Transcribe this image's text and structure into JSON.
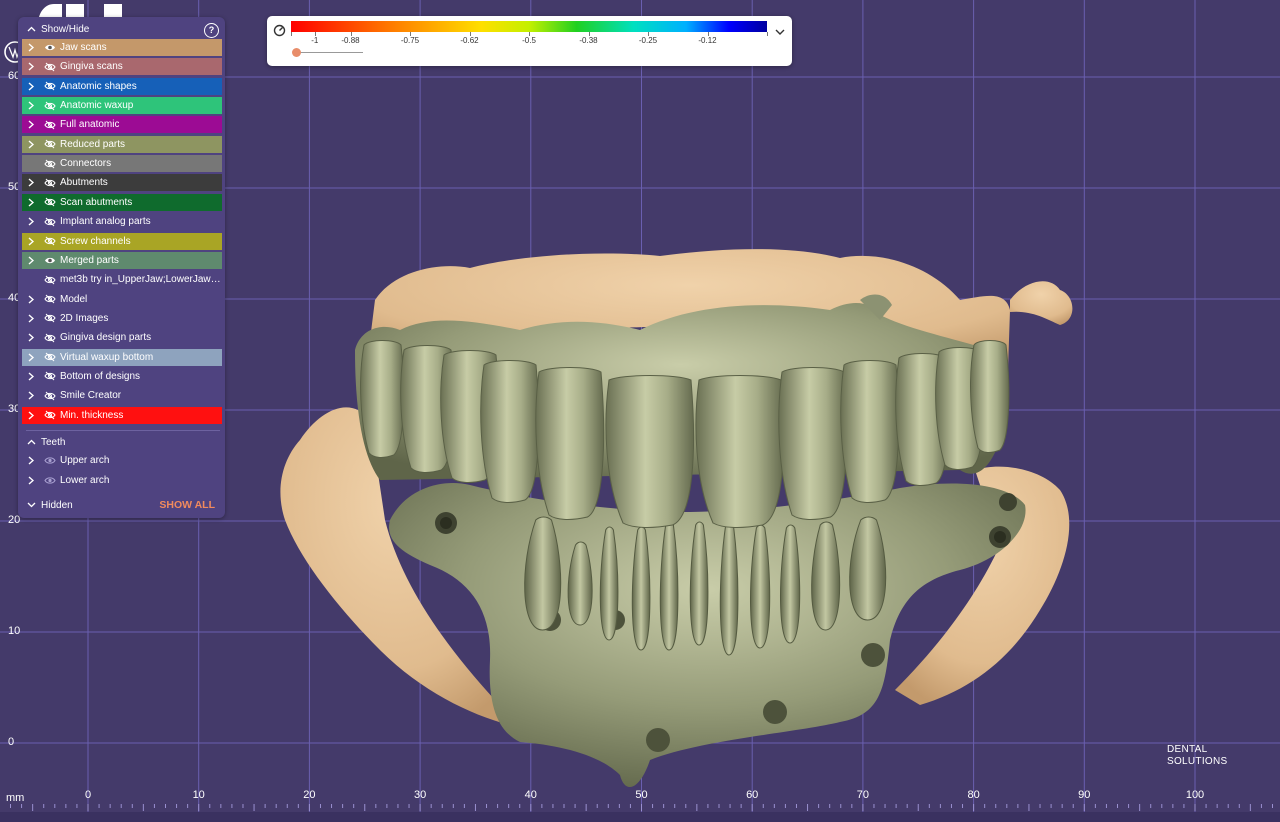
{
  "panel": {
    "show_hide_title": "Show/Hide",
    "help_label": "?",
    "items": [
      {
        "label": "Jaw scans",
        "color": "#c4986a",
        "visible": true,
        "expandable": true
      },
      {
        "label": "Gingiva scans",
        "color": "#a9686e",
        "visible": false,
        "expandable": true
      },
      {
        "label": "Anatomic shapes",
        "color": "#1660b8",
        "visible": false,
        "expandable": true
      },
      {
        "label": "Anatomic waxup",
        "color": "#2ec47a",
        "visible": false,
        "expandable": true
      },
      {
        "label": "Full anatomic",
        "color": "#9c0b94",
        "visible": false,
        "expandable": true
      },
      {
        "label": "Reduced parts",
        "color": "#8e9561",
        "visible": false,
        "expandable": true
      },
      {
        "label": "Connectors",
        "color": "#777777",
        "visible": false,
        "expandable": false
      },
      {
        "label": "Abutments",
        "color": "#3c3c3c",
        "visible": false,
        "expandable": true
      },
      {
        "label": "Scan abutments",
        "color": "#0f6b2d",
        "visible": false,
        "expandable": true
      },
      {
        "label": "Implant analog parts",
        "color": "",
        "visible": false,
        "expandable": true
      },
      {
        "label": "Screw channels",
        "color": "#a9a525",
        "visible": false,
        "expandable": true
      },
      {
        "label": "Merged parts",
        "color": "#5f8a6e",
        "visible": true,
        "expandable": true
      },
      {
        "label": "met3b try in_UpperJaw;LowerJaw (1...",
        "color": "",
        "visible": false,
        "expandable": false
      },
      {
        "label": "Model",
        "color": "",
        "visible": false,
        "expandable": true
      },
      {
        "label": "2D Images",
        "color": "",
        "visible": false,
        "expandable": true
      },
      {
        "label": "Gingiva design parts",
        "color": "",
        "visible": false,
        "expandable": true
      },
      {
        "label": "Virtual waxup bottom",
        "color": "#8ea3be",
        "visible": false,
        "expandable": true
      },
      {
        "label": "Bottom of designs",
        "color": "",
        "visible": false,
        "expandable": true
      },
      {
        "label": "Smile Creator",
        "color": "",
        "visible": false,
        "expandable": true
      },
      {
        "label": "Min. thickness",
        "color": "#ff1010",
        "visible": false,
        "expandable": true
      }
    ],
    "teeth_title": "Teeth",
    "teeth_items": [
      {
        "label": "Upper arch"
      },
      {
        "label": "Lower arch"
      }
    ],
    "hidden_title": "Hidden",
    "show_all_label": "SHOW ALL"
  },
  "scale": {
    "labels": [
      "-1",
      "-0.88",
      "-0.75",
      "-0.62",
      "-0.5",
      "-0.38",
      "-0.25",
      "-0.12"
    ],
    "slider_value": 0
  },
  "axes": {
    "unit": "mm",
    "y_labels": [
      "60",
      "50",
      "40",
      "30",
      "20",
      "10",
      "0"
    ],
    "x_labels": [
      "0",
      "10",
      "20",
      "30",
      "40",
      "50",
      "60",
      "70",
      "80",
      "90",
      "100"
    ]
  },
  "logo": {
    "line1": "DENTAL",
    "line2": "SOLUTIONS"
  },
  "colors": {
    "background": "#443a6a",
    "grid": "#6a5fb0",
    "panel": "#4f4380",
    "jaw_scan": "#e2bf93",
    "merged_parts": "#8f9473",
    "accent": "#f08a5d"
  }
}
